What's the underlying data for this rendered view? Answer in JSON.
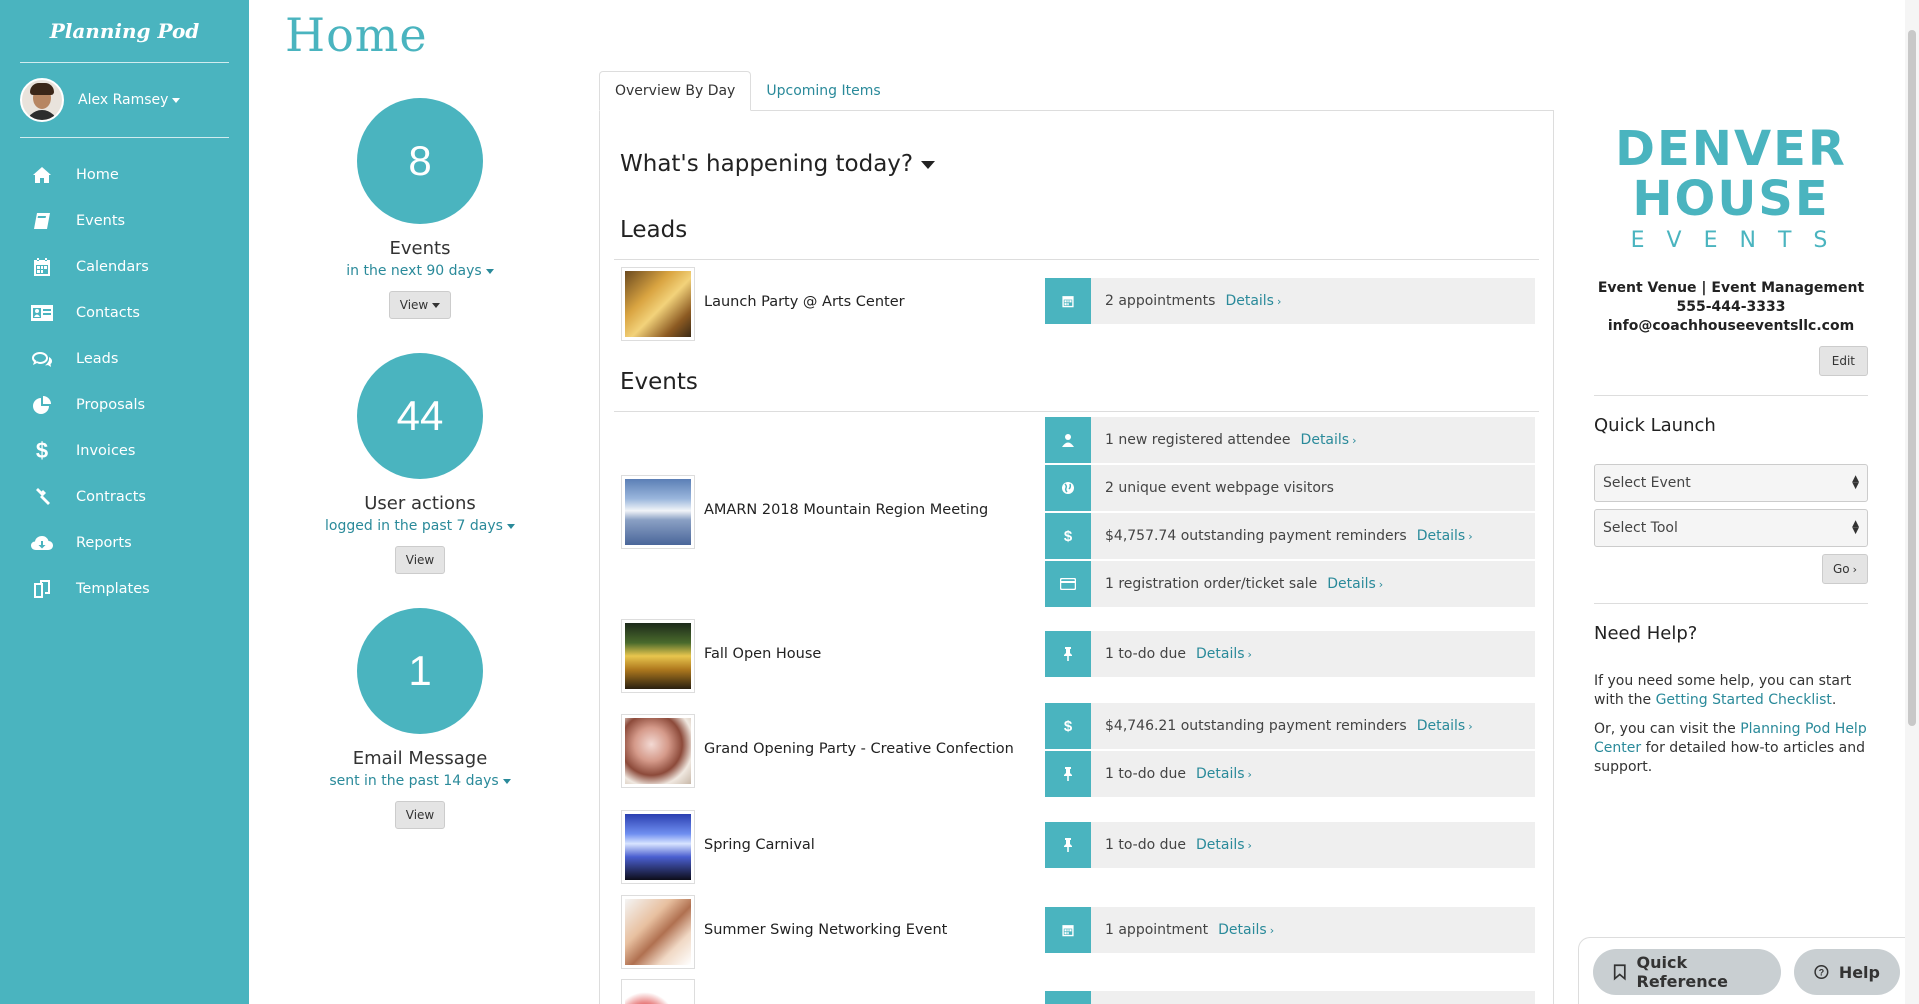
{
  "app": {
    "brand": "Planning Pod"
  },
  "user": {
    "name": "Alex Ramsey"
  },
  "nav": [
    {
      "label": "Home",
      "icon": "home-icon"
    },
    {
      "label": "Events",
      "icon": "events-icon"
    },
    {
      "label": "Calendars",
      "icon": "calendar-icon"
    },
    {
      "label": "Contacts",
      "icon": "contacts-icon"
    },
    {
      "label": "Leads",
      "icon": "leads-icon"
    },
    {
      "label": "Proposals",
      "icon": "pie-chart-icon"
    },
    {
      "label": "Invoices",
      "icon": "dollar-icon"
    },
    {
      "label": "Contracts",
      "icon": "gavel-icon"
    },
    {
      "label": "Reports",
      "icon": "cloud-download-icon"
    },
    {
      "label": "Templates",
      "icon": "templates-icon"
    }
  ],
  "page": {
    "title": "Home"
  },
  "stats": [
    {
      "value": "8",
      "label": "Events",
      "sub": "in the next 90 days",
      "button": "View",
      "button_has_caret": true
    },
    {
      "value": "44",
      "label": "User actions",
      "sub": "logged in the past 7 days",
      "button": "View"
    },
    {
      "value": "1",
      "label": "Email Message",
      "sub": "sent in the past 14 days",
      "button": "View"
    }
  ],
  "tabs": {
    "active": "Overview By Day",
    "inactive": "Upcoming Items"
  },
  "overview": {
    "heading": "What's happening today?",
    "leads_heading": "Leads",
    "events_heading": "Events",
    "details": "Details",
    "leads": [
      {
        "name": "Launch Party @ Arts Center",
        "items": [
          {
            "icon": "calendar-icon",
            "text": "2 appointments",
            "link": true
          }
        ]
      }
    ],
    "events": [
      {
        "name": "AMARN 2018 Mountain Region Meeting",
        "items": [
          {
            "icon": "user-icon",
            "text": "1 new registered attendee",
            "link": true
          },
          {
            "icon": "globe-icon",
            "text": "2 unique event webpage visitors",
            "link": false
          },
          {
            "icon": "dollar-icon",
            "text": "$4,757.74 outstanding payment reminders",
            "link": true
          },
          {
            "icon": "credit-card-icon",
            "text": "1 registration order/ticket sale",
            "link": true
          }
        ]
      },
      {
        "name": "Fall Open House",
        "items": [
          {
            "icon": "pin-icon",
            "text": "1 to-do due",
            "link": true
          }
        ]
      },
      {
        "name": "Grand Opening Party - Creative Confection",
        "items": [
          {
            "icon": "dollar-icon",
            "text": "$4,746.21 outstanding payment reminders",
            "link": true
          },
          {
            "icon": "pin-icon",
            "text": "1 to-do due",
            "link": true
          }
        ]
      },
      {
        "name": "Spring Carnival",
        "items": [
          {
            "icon": "pin-icon",
            "text": "1 to-do due",
            "link": true
          }
        ]
      },
      {
        "name": "Summer Swing Networking Event",
        "items": [
          {
            "icon": "calendar-icon",
            "text": "1 appointment",
            "link": true
          }
        ]
      }
    ]
  },
  "company": {
    "logo_line1": "DENVER",
    "logo_line2": "HOUSE",
    "logo_line3": "EVENTS",
    "tagline": "Event Venue | Event Management",
    "phone": "555-444-3333",
    "email": "info@coachhouseeventsllc.com",
    "edit": "Edit"
  },
  "quick_launch": {
    "title": "Quick Launch",
    "select_event": "Select Event",
    "select_tool": "Select Tool",
    "go": "Go"
  },
  "help": {
    "title": "Need Help?",
    "p1_prefix": "If you need some help, you can start with the ",
    "p1_link": "Getting Started Checklist",
    "p1_suffix": ".",
    "p2_prefix": "Or, you can visit the ",
    "p2_link": "Planning Pod Help Center",
    "p2_suffix": " for detailed how-to articles and support."
  },
  "bottom": {
    "quick_reference": "Quick Reference",
    "help": "Help"
  },
  "colors": {
    "accent": "#4ab4bf",
    "link": "#2a8a9a"
  }
}
